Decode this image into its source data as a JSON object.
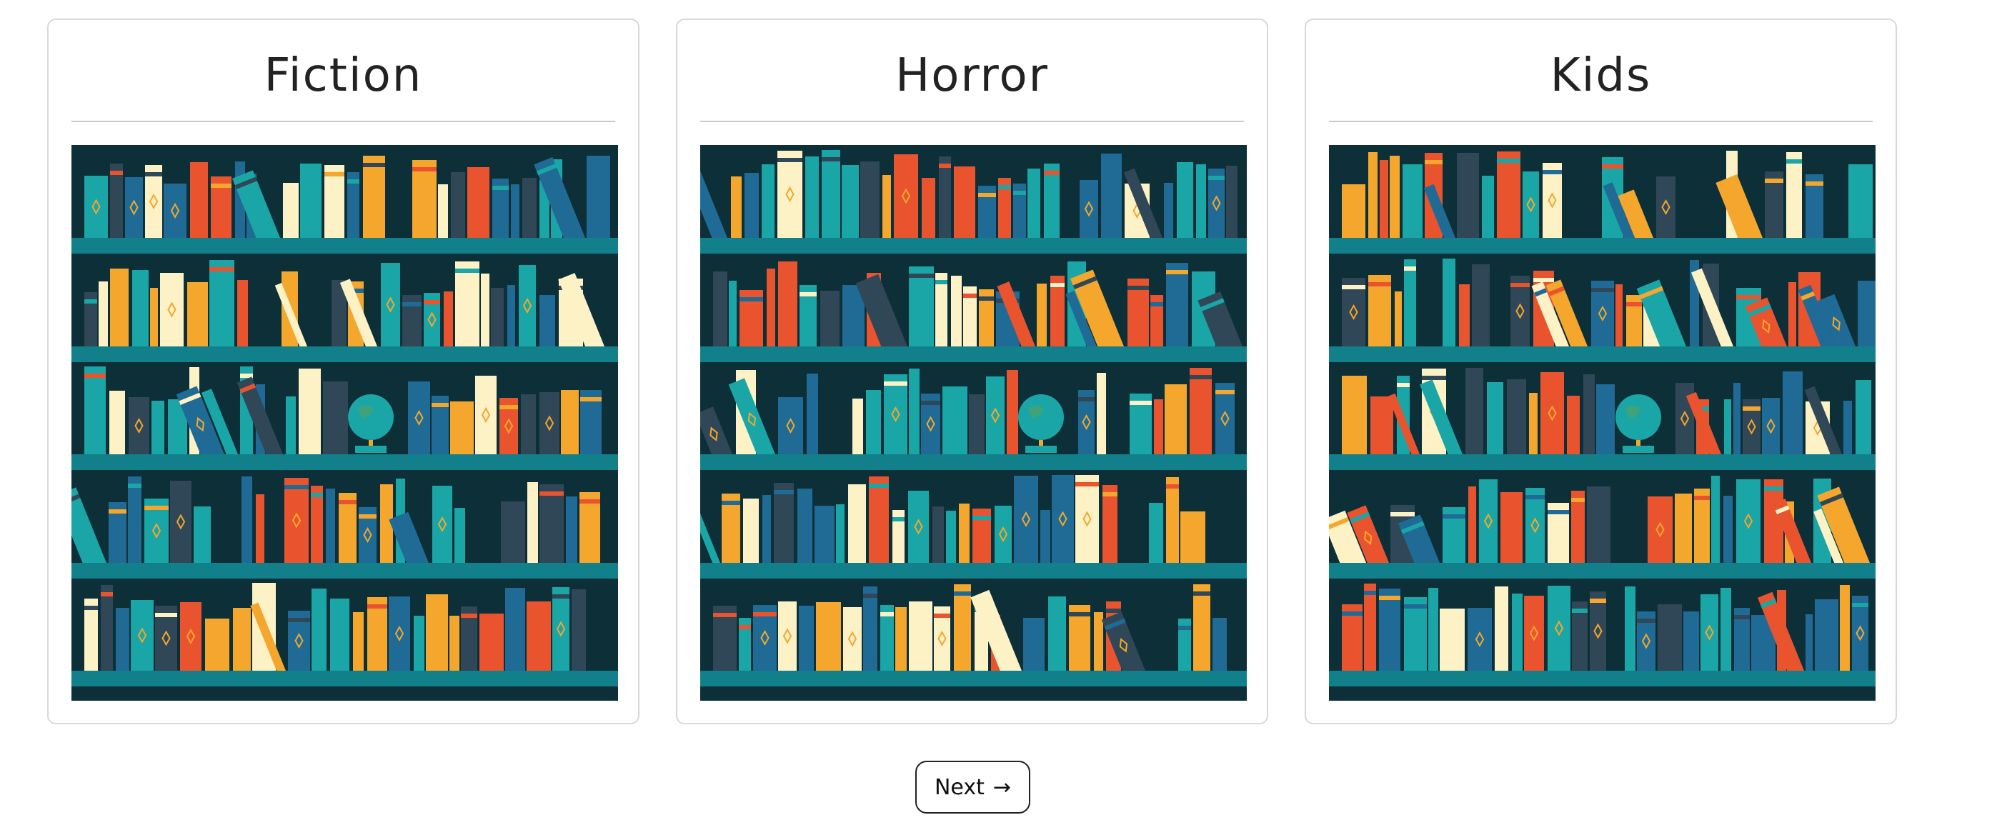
{
  "categories": [
    {
      "title": "Fiction",
      "image_alt": "bookshelf-illustration"
    },
    {
      "title": "Horror",
      "image_alt": "bookshelf-illustration"
    },
    {
      "title": "Kids",
      "image_alt": "bookshelf-illustration"
    }
  ],
  "navigation": {
    "next_label": "Next",
    "next_icon": "→"
  },
  "colors": {
    "shelf_background": "#0c2f38",
    "shelf_plank": "#12808a",
    "book_teal": "#1aa6a6",
    "book_orange": "#e9542f",
    "book_yellow": "#f4a72c",
    "book_cream": "#fdf1c6",
    "book_blue": "#1f6b96",
    "book_slate": "#2f4756",
    "globe_green": "#3fa37a",
    "card_border": "#d8d8d8"
  }
}
